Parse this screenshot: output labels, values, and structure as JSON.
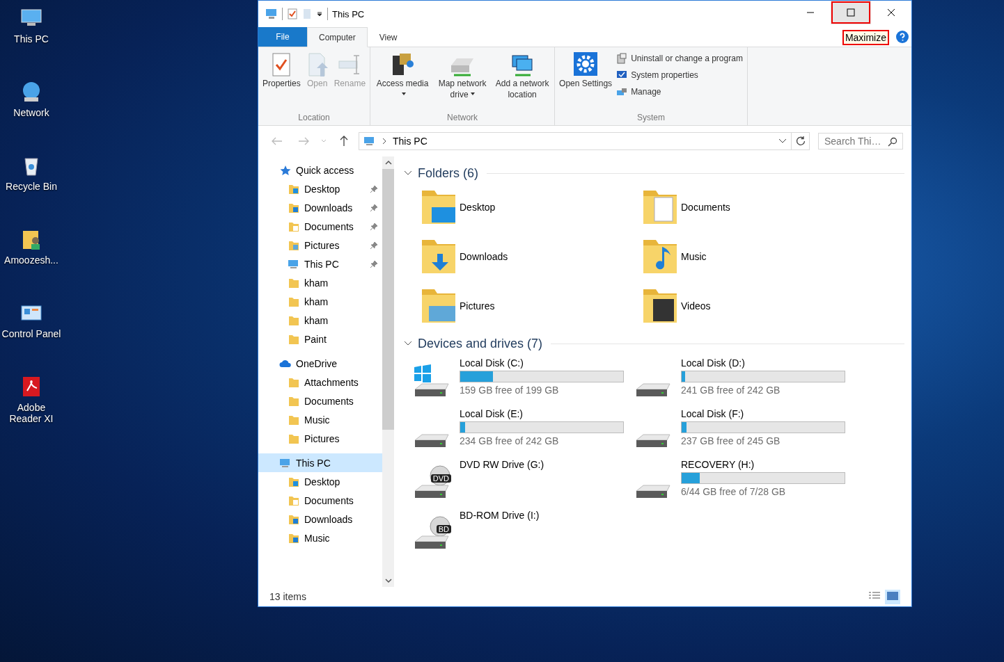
{
  "desktop_icons": [
    {
      "label": "This PC",
      "kind": "pc"
    },
    {
      "label": "Network",
      "kind": "network"
    },
    {
      "label": "Recycle Bin",
      "kind": "bin"
    },
    {
      "label": "Amoozesh...",
      "kind": "userfolder"
    },
    {
      "label": "Control Panel",
      "kind": "control"
    },
    {
      "label": "Adobe Reader XI",
      "kind": "pdf"
    }
  ],
  "window": {
    "title": "This PC",
    "tooltip": "Maximize"
  },
  "ribbon": {
    "tabs": [
      {
        "label": "File",
        "kind": "file",
        "selected": false
      },
      {
        "label": "Computer",
        "kind": "tab",
        "selected": true
      },
      {
        "label": "View",
        "kind": "tab",
        "selected": false
      }
    ],
    "groups": [
      {
        "label": "Location",
        "buttons": [
          {
            "label": "Properties",
            "kind": "properties",
            "disabled": false,
            "menu": false
          },
          {
            "label": "Open",
            "kind": "open",
            "disabled": true,
            "menu": false
          },
          {
            "label": "Rename",
            "kind": "rename",
            "disabled": true,
            "menu": false
          }
        ]
      },
      {
        "label": "Network",
        "buttons": [
          {
            "label": "Access media",
            "kind": "media",
            "disabled": false,
            "menu": true
          },
          {
            "label": "Map network drive",
            "kind": "mapdrive",
            "disabled": false,
            "menu": true
          },
          {
            "label": "Add a network location",
            "kind": "netloc",
            "disabled": false,
            "menu": false
          }
        ]
      },
      {
        "label": "System",
        "buttons": [
          {
            "label": "Open Settings",
            "kind": "settings",
            "disabled": false,
            "menu": false
          }
        ],
        "small_buttons": [
          {
            "label": "Uninstall or change a program",
            "kind": "uninstall"
          },
          {
            "label": "System properties",
            "kind": "sysprops"
          },
          {
            "label": "Manage",
            "kind": "manage"
          }
        ]
      }
    ]
  },
  "address_bar": {
    "path": "This PC",
    "search_placeholder": "Search Thi…"
  },
  "navigation_pane": [
    {
      "label": "Quick access",
      "kind": "star",
      "selected": false,
      "children": [
        {
          "label": "Desktop",
          "kind": "desktop",
          "pinned": true,
          "selected": false
        },
        {
          "label": "Downloads",
          "kind": "downloads",
          "pinned": true,
          "selected": false
        },
        {
          "label": "Documents",
          "kind": "documents",
          "pinned": true,
          "selected": false
        },
        {
          "label": "Pictures",
          "kind": "pictures",
          "pinned": true,
          "selected": false
        },
        {
          "label": "This PC",
          "kind": "pc",
          "pinned": true,
          "selected": false
        },
        {
          "label": "kham",
          "kind": "folder",
          "pinned": false,
          "selected": false
        },
        {
          "label": "kham",
          "kind": "folder",
          "pinned": false,
          "selected": false
        },
        {
          "label": "kham",
          "kind": "folder",
          "pinned": false,
          "selected": false
        },
        {
          "label": "Paint",
          "kind": "folder",
          "pinned": false,
          "selected": false
        }
      ]
    },
    {
      "label": "OneDrive",
      "kind": "cloud",
      "selected": false,
      "children": [
        {
          "label": "Attachments",
          "kind": "folder",
          "pinned": false,
          "selected": false
        },
        {
          "label": "Documents",
          "kind": "folder",
          "pinned": false,
          "selected": false
        },
        {
          "label": "Music",
          "kind": "folder",
          "pinned": false,
          "selected": false
        },
        {
          "label": "Pictures",
          "kind": "folder",
          "pinned": false,
          "selected": false
        }
      ]
    },
    {
      "label": "This PC",
      "kind": "pc",
      "selected": true,
      "children": [
        {
          "label": "Desktop",
          "kind": "desktop",
          "pinned": false,
          "selected": false
        },
        {
          "label": "Documents",
          "kind": "documents",
          "pinned": false,
          "selected": false
        },
        {
          "label": "Downloads",
          "kind": "downloads",
          "pinned": false,
          "selected": false
        },
        {
          "label": "Music",
          "kind": "music",
          "pinned": false,
          "selected": false
        }
      ]
    }
  ],
  "folders": {
    "title": "Folders (6)",
    "expanded": true,
    "items": [
      {
        "label": "Desktop",
        "kind": "desktop"
      },
      {
        "label": "Documents",
        "kind": "documents"
      },
      {
        "label": "Downloads",
        "kind": "downloads"
      },
      {
        "label": "Music",
        "kind": "music"
      },
      {
        "label": "Pictures",
        "kind": "pictures"
      },
      {
        "label": "Videos",
        "kind": "videos"
      }
    ]
  },
  "drives": {
    "title": "Devices and drives (7)",
    "expanded": true,
    "items": [
      {
        "label": "Local Disk (C:)",
        "kind": "system",
        "level": 0.2,
        "free": "159 GB free of 199 GB"
      },
      {
        "label": "Local Disk (D:)",
        "kind": "disk",
        "level": 0.02,
        "free": "241 GB free of 242 GB"
      },
      {
        "label": "Local Disk (E:)",
        "kind": "disk",
        "level": 0.03,
        "free": "234 GB free of 242 GB"
      },
      {
        "label": "Local Disk (F:)",
        "kind": "disk",
        "level": 0.03,
        "free": "237 GB free of 245 GB"
      },
      {
        "label": "DVD RW Drive (G:)",
        "kind": "optical",
        "badge": "DVD"
      },
      {
        "label": "RECOVERY (H:)",
        "kind": "disk",
        "level": 0.11,
        "free": "6/44 GB free of 7/28 GB"
      },
      {
        "label": "BD-ROM Drive (I:)",
        "kind": "optical",
        "badge": "BD"
      }
    ]
  },
  "status_bar": {
    "count": "13 items"
  }
}
